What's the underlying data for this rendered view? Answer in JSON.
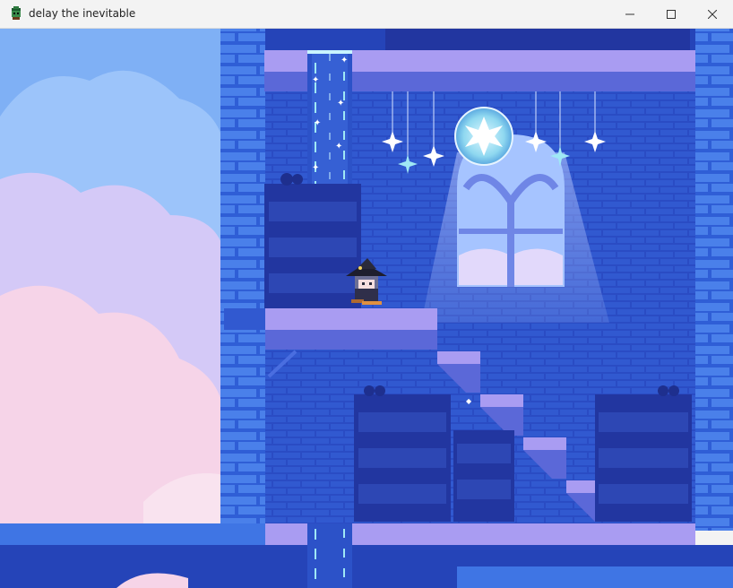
{
  "window": {
    "title": "delay the inevitable",
    "controls": {
      "minimize_icon": "minimize-icon",
      "maximize_icon": "maximize-icon",
      "close_icon": "close-icon"
    }
  },
  "scene": {
    "palette": {
      "sky": "#7fb0f5",
      "cloud_white": "#e6ecff",
      "cloud_lavender": "#d4c9f7",
      "cloud_pink": "#f6d4e8",
      "brick_light": "#3b6fe0",
      "brick_dark": "#2544b8",
      "platform_top": "#a99cf2",
      "platform_side": "#5b68d8",
      "bookshelf": "#2236a0",
      "crystal": "#9fe8f5"
    },
    "icons": [
      "witch-player",
      "crystal-orb",
      "star-ornament",
      "waterfall",
      "bookshelf",
      "arched-window"
    ]
  }
}
